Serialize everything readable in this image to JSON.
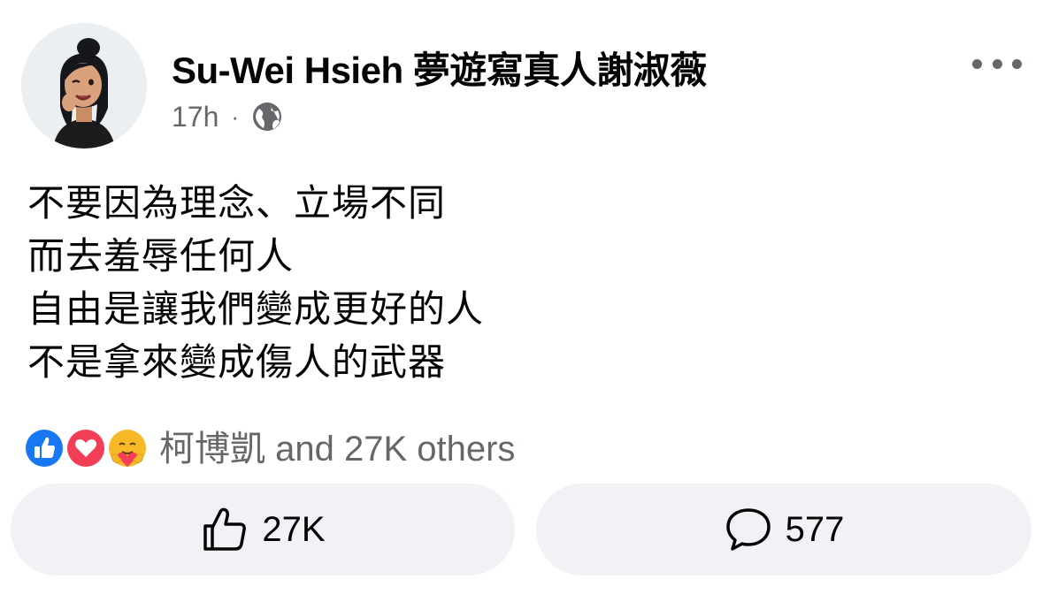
{
  "header": {
    "author_name": "Su-Wei Hsieh 夢遊寫真人謝淑薇",
    "timestamp": "17h",
    "separator": "·",
    "privacy_icon": "globe-icon",
    "menu_icon": "more-horizontal-icon"
  },
  "post": {
    "lines": [
      "不要因為理念、立場不同",
      "而去羞辱任何人",
      "自由是讓我們變成更好的人",
      "不是拿來變成傷人的武器"
    ]
  },
  "reactions": {
    "icons": [
      "like-reaction-icon",
      "love-reaction-icon",
      "care-reaction-icon"
    ],
    "summary": "柯博凱 and 27K others"
  },
  "actions": {
    "like_count": "27K",
    "comment_count": "577"
  },
  "colors": {
    "like_blue": "#1877f2",
    "love_red": "#f33e58",
    "care_yellow": "#f7b928",
    "secondary_text": "#65676b",
    "button_bg": "#f0f2f5"
  }
}
